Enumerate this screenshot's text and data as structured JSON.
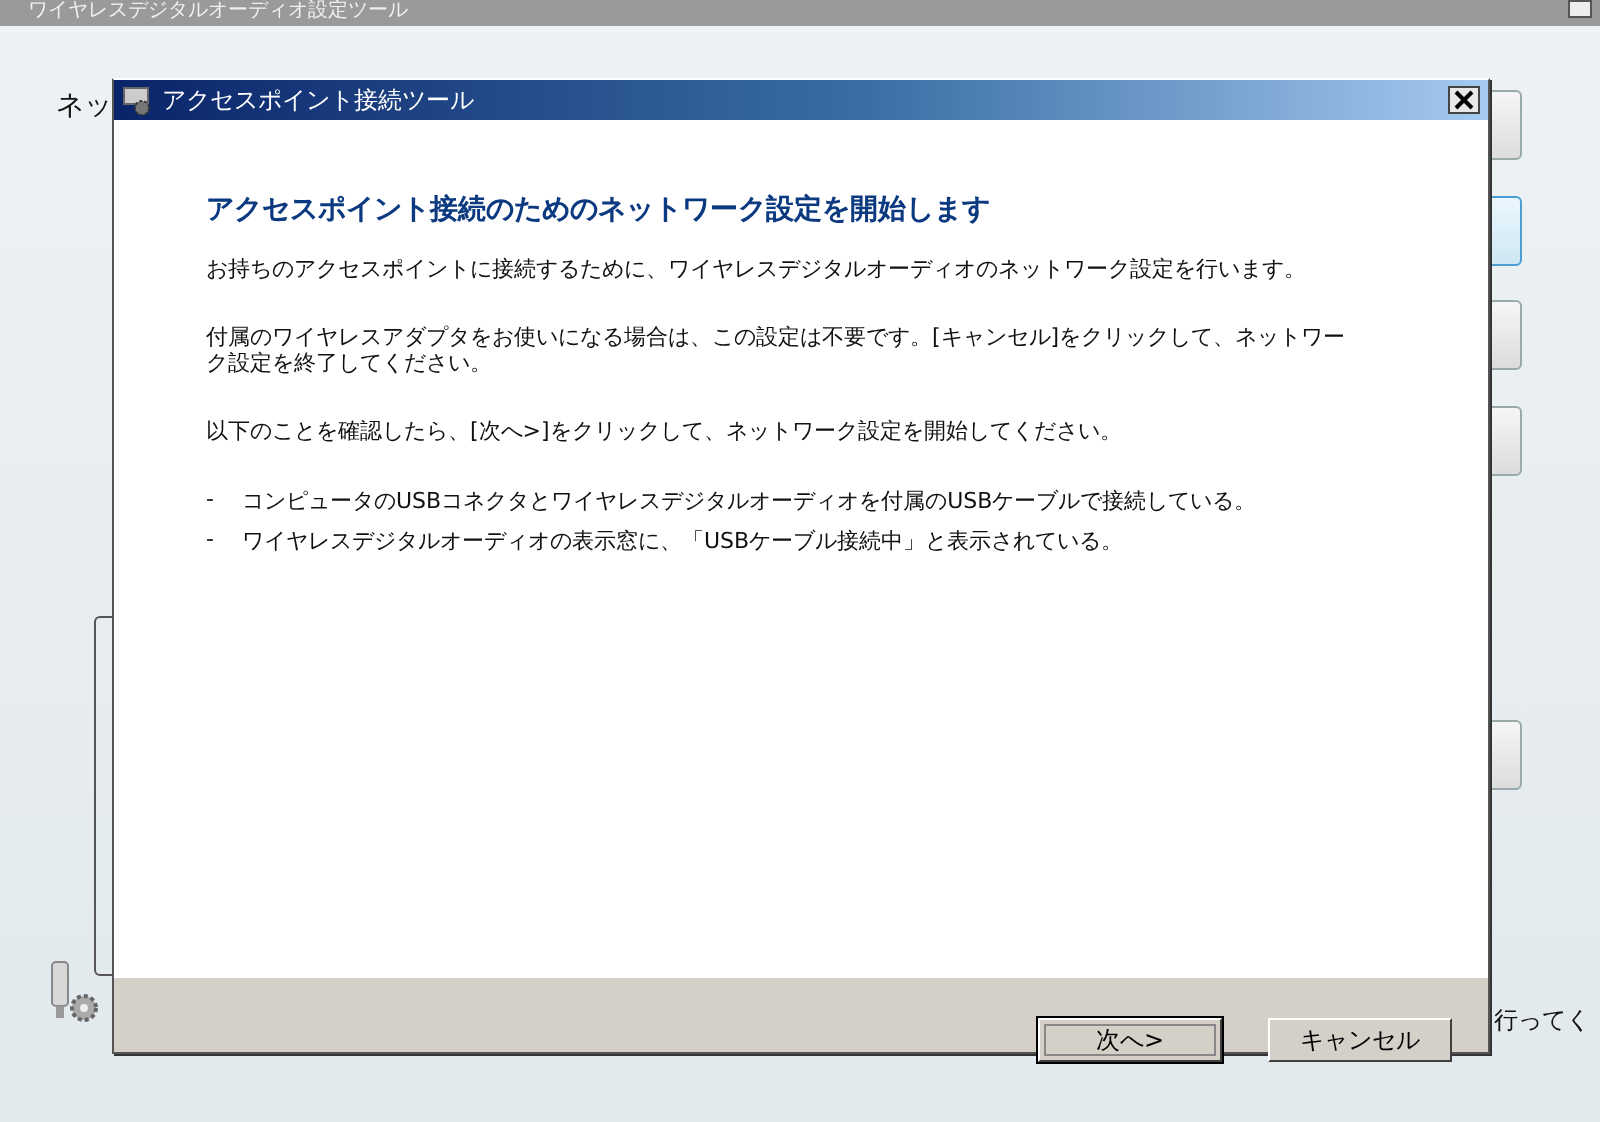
{
  "background_window": {
    "title": "ワイヤレスデジタルオーディオ設定ツール",
    "label": "ネッ",
    "footer_text": "行ってく"
  },
  "dialog": {
    "title": "アクセスポイント接続ツール",
    "heading": "アクセスポイント接続のためのネットワーク設定を開始します",
    "paragraphs": [
      "お持ちのアクセスポイントに接続するために、ワイヤレスデジタルオーディオのネットワーク設定を行います。",
      "付属のワイヤレスアダプタをお使いになる場合は、この設定は不要です。[キャンセル]をクリックして、ネットワーク設定を終了してください。",
      "以下のことを確認したら、[次へ>]をクリックして、ネットワーク設定を開始してください。"
    ],
    "bullets": [
      {
        "marker": "-",
        "text": "コンピュータのUSBコネクタとワイヤレスデジタルオーディオを付属のUSBケーブルで接続している。"
      },
      {
        "marker": "-",
        "text": "ワイヤレスデジタルオーディオの表示窓に、「USBケーブル接続中」と表示されている。"
      }
    ],
    "buttons": [
      {
        "label": "次へ>",
        "default": true
      },
      {
        "label": "キャンセル",
        "default": false
      }
    ]
  }
}
